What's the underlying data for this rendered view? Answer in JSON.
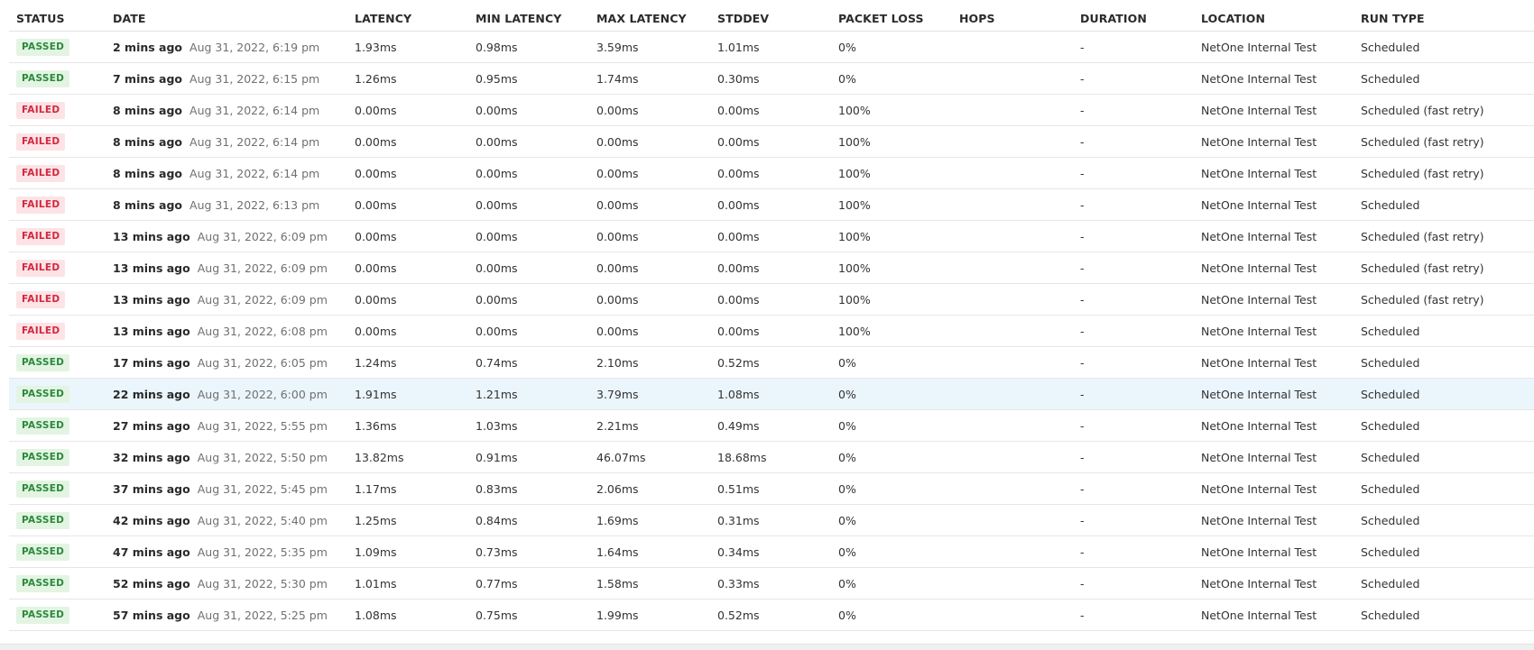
{
  "columns": [
    "STATUS",
    "DATE",
    "LATENCY",
    "MIN LATENCY",
    "MAX LATENCY",
    "STDDEV",
    "PACKET LOSS",
    "HOPS",
    "DURATION",
    "LOCATION",
    "RUN TYPE"
  ],
  "colors": {
    "passed_bg": "#e3f4e3",
    "passed_text": "#2a8a3c",
    "failed_bg": "#fde3e6",
    "failed_text": "#d0293f",
    "highlight_row": "#ebf5fc"
  },
  "rows": [
    {
      "status": "PASSED",
      "date_rel": "2 mins ago",
      "date_abs": "Aug 31, 2022, 6:19 pm",
      "latency": "1.93ms",
      "min_latency": "0.98ms",
      "max_latency": "3.59ms",
      "stddev": "1.01ms",
      "packet_loss": "0%",
      "hops": "",
      "duration": "-",
      "location": "NetOne Internal Test",
      "run_type": "Scheduled"
    },
    {
      "status": "PASSED",
      "date_rel": "7 mins ago",
      "date_abs": "Aug 31, 2022, 6:15 pm",
      "latency": "1.26ms",
      "min_latency": "0.95ms",
      "max_latency": "1.74ms",
      "stddev": "0.30ms",
      "packet_loss": "0%",
      "hops": "",
      "duration": "-",
      "location": "NetOne Internal Test",
      "run_type": "Scheduled"
    },
    {
      "status": "FAILED",
      "date_rel": "8 mins ago",
      "date_abs": "Aug 31, 2022, 6:14 pm",
      "latency": "0.00ms",
      "min_latency": "0.00ms",
      "max_latency": "0.00ms",
      "stddev": "0.00ms",
      "packet_loss": "100%",
      "hops": "",
      "duration": "-",
      "location": "NetOne Internal Test",
      "run_type": "Scheduled (fast retry)"
    },
    {
      "status": "FAILED",
      "date_rel": "8 mins ago",
      "date_abs": "Aug 31, 2022, 6:14 pm",
      "latency": "0.00ms",
      "min_latency": "0.00ms",
      "max_latency": "0.00ms",
      "stddev": "0.00ms",
      "packet_loss": "100%",
      "hops": "",
      "duration": "-",
      "location": "NetOne Internal Test",
      "run_type": "Scheduled (fast retry)"
    },
    {
      "status": "FAILED",
      "date_rel": "8 mins ago",
      "date_abs": "Aug 31, 2022, 6:14 pm",
      "latency": "0.00ms",
      "min_latency": "0.00ms",
      "max_latency": "0.00ms",
      "stddev": "0.00ms",
      "packet_loss": "100%",
      "hops": "",
      "duration": "-",
      "location": "NetOne Internal Test",
      "run_type": "Scheduled (fast retry)"
    },
    {
      "status": "FAILED",
      "date_rel": "8 mins ago",
      "date_abs": "Aug 31, 2022, 6:13 pm",
      "latency": "0.00ms",
      "min_latency": "0.00ms",
      "max_latency": "0.00ms",
      "stddev": "0.00ms",
      "packet_loss": "100%",
      "hops": "",
      "duration": "-",
      "location": "NetOne Internal Test",
      "run_type": "Scheduled"
    },
    {
      "status": "FAILED",
      "date_rel": "13 mins ago",
      "date_abs": "Aug 31, 2022, 6:09 pm",
      "latency": "0.00ms",
      "min_latency": "0.00ms",
      "max_latency": "0.00ms",
      "stddev": "0.00ms",
      "packet_loss": "100%",
      "hops": "",
      "duration": "-",
      "location": "NetOne Internal Test",
      "run_type": "Scheduled (fast retry)"
    },
    {
      "status": "FAILED",
      "date_rel": "13 mins ago",
      "date_abs": "Aug 31, 2022, 6:09 pm",
      "latency": "0.00ms",
      "min_latency": "0.00ms",
      "max_latency": "0.00ms",
      "stddev": "0.00ms",
      "packet_loss": "100%",
      "hops": "",
      "duration": "-",
      "location": "NetOne Internal Test",
      "run_type": "Scheduled (fast retry)"
    },
    {
      "status": "FAILED",
      "date_rel": "13 mins ago",
      "date_abs": "Aug 31, 2022, 6:09 pm",
      "latency": "0.00ms",
      "min_latency": "0.00ms",
      "max_latency": "0.00ms",
      "stddev": "0.00ms",
      "packet_loss": "100%",
      "hops": "",
      "duration": "-",
      "location": "NetOne Internal Test",
      "run_type": "Scheduled (fast retry)"
    },
    {
      "status": "FAILED",
      "date_rel": "13 mins ago",
      "date_abs": "Aug 31, 2022, 6:08 pm",
      "latency": "0.00ms",
      "min_latency": "0.00ms",
      "max_latency": "0.00ms",
      "stddev": "0.00ms",
      "packet_loss": "100%",
      "hops": "",
      "duration": "-",
      "location": "NetOne Internal Test",
      "run_type": "Scheduled"
    },
    {
      "status": "PASSED",
      "date_rel": "17 mins ago",
      "date_abs": "Aug 31, 2022, 6:05 pm",
      "latency": "1.24ms",
      "min_latency": "0.74ms",
      "max_latency": "2.10ms",
      "stddev": "0.52ms",
      "packet_loss": "0%",
      "hops": "",
      "duration": "-",
      "location": "NetOne Internal Test",
      "run_type": "Scheduled"
    },
    {
      "status": "PASSED",
      "date_rel": "22 mins ago",
      "date_abs": "Aug 31, 2022, 6:00 pm",
      "latency": "1.91ms",
      "min_latency": "1.21ms",
      "max_latency": "3.79ms",
      "stddev": "1.08ms",
      "packet_loss": "0%",
      "hops": "",
      "duration": "-",
      "location": "NetOne Internal Test",
      "run_type": "Scheduled",
      "highlighted": true
    },
    {
      "status": "PASSED",
      "date_rel": "27 mins ago",
      "date_abs": "Aug 31, 2022, 5:55 pm",
      "latency": "1.36ms",
      "min_latency": "1.03ms",
      "max_latency": "2.21ms",
      "stddev": "0.49ms",
      "packet_loss": "0%",
      "hops": "",
      "duration": "-",
      "location": "NetOne Internal Test",
      "run_type": "Scheduled"
    },
    {
      "status": "PASSED",
      "date_rel": "32 mins ago",
      "date_abs": "Aug 31, 2022, 5:50 pm",
      "latency": "13.82ms",
      "min_latency": "0.91ms",
      "max_latency": "46.07ms",
      "stddev": "18.68ms",
      "packet_loss": "0%",
      "hops": "",
      "duration": "-",
      "location": "NetOne Internal Test",
      "run_type": "Scheduled"
    },
    {
      "status": "PASSED",
      "date_rel": "37 mins ago",
      "date_abs": "Aug 31, 2022, 5:45 pm",
      "latency": "1.17ms",
      "min_latency": "0.83ms",
      "max_latency": "2.06ms",
      "stddev": "0.51ms",
      "packet_loss": "0%",
      "hops": "",
      "duration": "-",
      "location": "NetOne Internal Test",
      "run_type": "Scheduled"
    },
    {
      "status": "PASSED",
      "date_rel": "42 mins ago",
      "date_abs": "Aug 31, 2022, 5:40 pm",
      "latency": "1.25ms",
      "min_latency": "0.84ms",
      "max_latency": "1.69ms",
      "stddev": "0.31ms",
      "packet_loss": "0%",
      "hops": "",
      "duration": "-",
      "location": "NetOne Internal Test",
      "run_type": "Scheduled"
    },
    {
      "status": "PASSED",
      "date_rel": "47 mins ago",
      "date_abs": "Aug 31, 2022, 5:35 pm",
      "latency": "1.09ms",
      "min_latency": "0.73ms",
      "max_latency": "1.64ms",
      "stddev": "0.34ms",
      "packet_loss": "0%",
      "hops": "",
      "duration": "-",
      "location": "NetOne Internal Test",
      "run_type": "Scheduled"
    },
    {
      "status": "PASSED",
      "date_rel": "52 mins ago",
      "date_abs": "Aug 31, 2022, 5:30 pm",
      "latency": "1.01ms",
      "min_latency": "0.77ms",
      "max_latency": "1.58ms",
      "stddev": "0.33ms",
      "packet_loss": "0%",
      "hops": "",
      "duration": "-",
      "location": "NetOne Internal Test",
      "run_type": "Scheduled"
    },
    {
      "status": "PASSED",
      "date_rel": "57 mins ago",
      "date_abs": "Aug 31, 2022, 5:25 pm",
      "latency": "1.08ms",
      "min_latency": "0.75ms",
      "max_latency": "1.99ms",
      "stddev": "0.52ms",
      "packet_loss": "0%",
      "hops": "",
      "duration": "-",
      "location": "NetOne Internal Test",
      "run_type": "Scheduled"
    }
  ]
}
